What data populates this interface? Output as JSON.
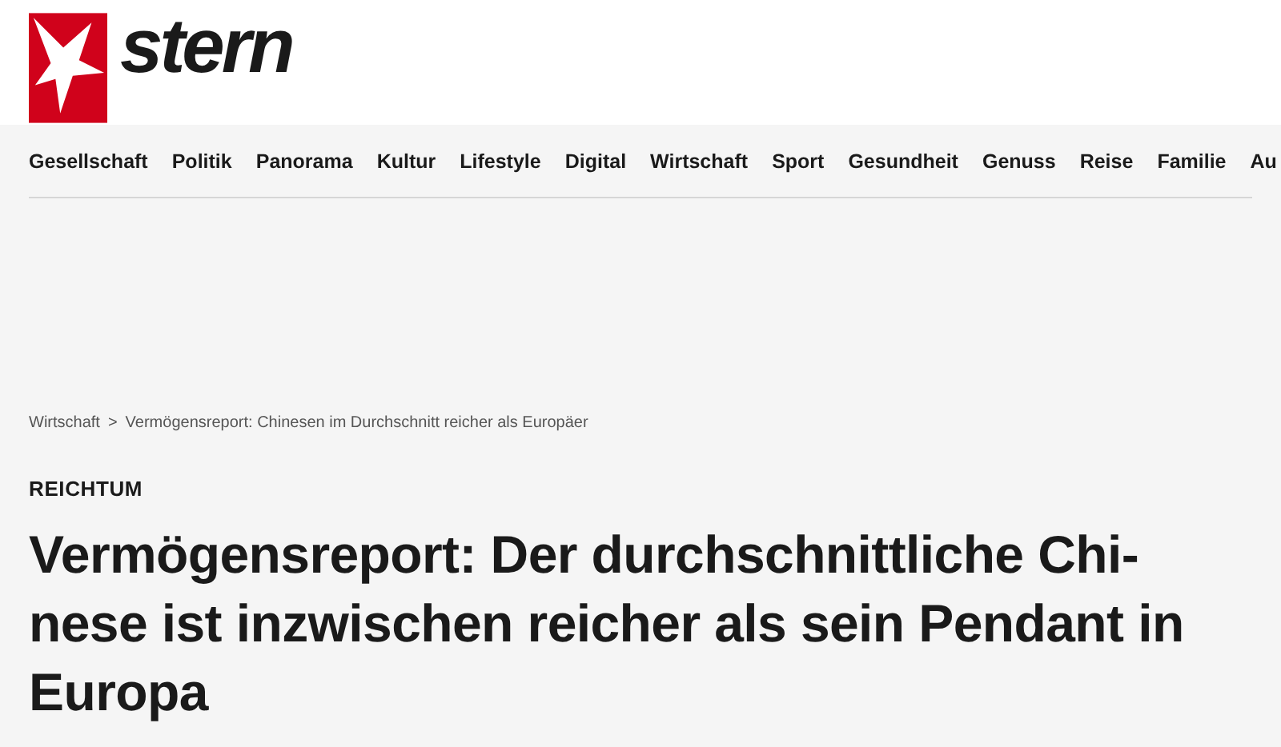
{
  "logo": {
    "wordmark": "stern"
  },
  "nav": [
    {
      "label": "Gesellschaft"
    },
    {
      "label": "Politik"
    },
    {
      "label": "Panorama"
    },
    {
      "label": "Kultur"
    },
    {
      "label": "Lifestyle"
    },
    {
      "label": "Digital"
    },
    {
      "label": "Wirtschaft"
    },
    {
      "label": "Sport"
    },
    {
      "label": "Gesundheit"
    },
    {
      "label": "Genuss"
    },
    {
      "label": "Reise"
    },
    {
      "label": "Familie"
    },
    {
      "label": "Au"
    }
  ],
  "breadcrumb": {
    "items": [
      "Wirtschaft",
      "Vermögensreport: Chinesen im Durchschnitt reicher als Europäer"
    ],
    "separator": ">"
  },
  "article": {
    "kicker": "REICHTUM",
    "headline": "Vermögensreport: Der durchschnittliche Chi-\nnese ist inzwischen reicher als sein Pendant in\nEuropa"
  }
}
